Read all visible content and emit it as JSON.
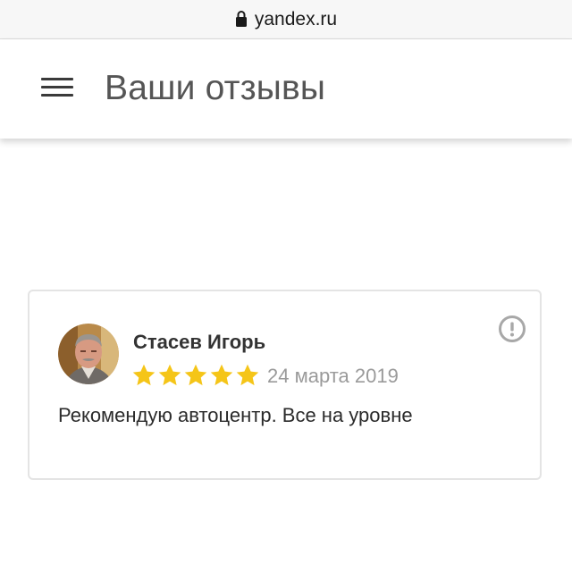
{
  "browser": {
    "url": "yandex.ru",
    "lock_icon": "lock-icon"
  },
  "header": {
    "menu_icon": "hamburger-menu-icon",
    "title": "Ваши отзывы"
  },
  "review": {
    "author": "Стасев Игорь",
    "rating": 5,
    "rating_max": 5,
    "date": "24 марта 2019",
    "text": "Рекомендую автоцентр. Все на уровне",
    "report_icon": "exclamation-circle-icon",
    "star_color": "#f5c518"
  }
}
